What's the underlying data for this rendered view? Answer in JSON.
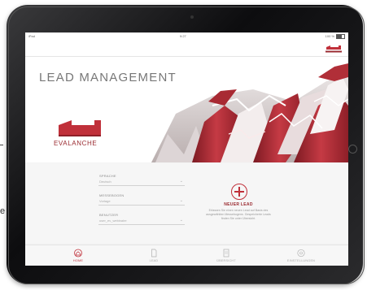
{
  "edge": {
    "text": "e"
  },
  "statusbar": {
    "carrier": "iPad",
    "time": "9:27",
    "battery": "100 %"
  },
  "app": {
    "title": "LEAD MANAGEMENT",
    "brand": "EVALANCHE"
  },
  "colors": {
    "accent": "#c0303a",
    "dark_red": "#9a2a30",
    "bezel": "#141416",
    "background": "#f4f4f4"
  },
  "form": {
    "language": {
      "label": "SPRACHE",
      "value": "Deutsch"
    },
    "mailing": {
      "label": "MESSEBOGEN",
      "value": "Vorlage"
    },
    "user": {
      "label": "BENUTZER",
      "value": "user_ev_webinaire"
    }
  },
  "new_lead": {
    "title": "NEUER LEAD",
    "description": "Erfassen Sie einen neuen Lead auf Basis des ausgewählten Messebogens. Gespeicherte Leads finden Sie unter Übersicht."
  },
  "tabs": [
    {
      "label": "HOME",
      "icon": "home-icon",
      "active": true
    },
    {
      "label": "LEAD",
      "icon": "document-icon",
      "active": false
    },
    {
      "label": "ÜBERSICHT",
      "icon": "list-icon",
      "active": false
    },
    {
      "label": "EINSTELLUNGEN",
      "icon": "settings-icon",
      "active": false
    }
  ]
}
